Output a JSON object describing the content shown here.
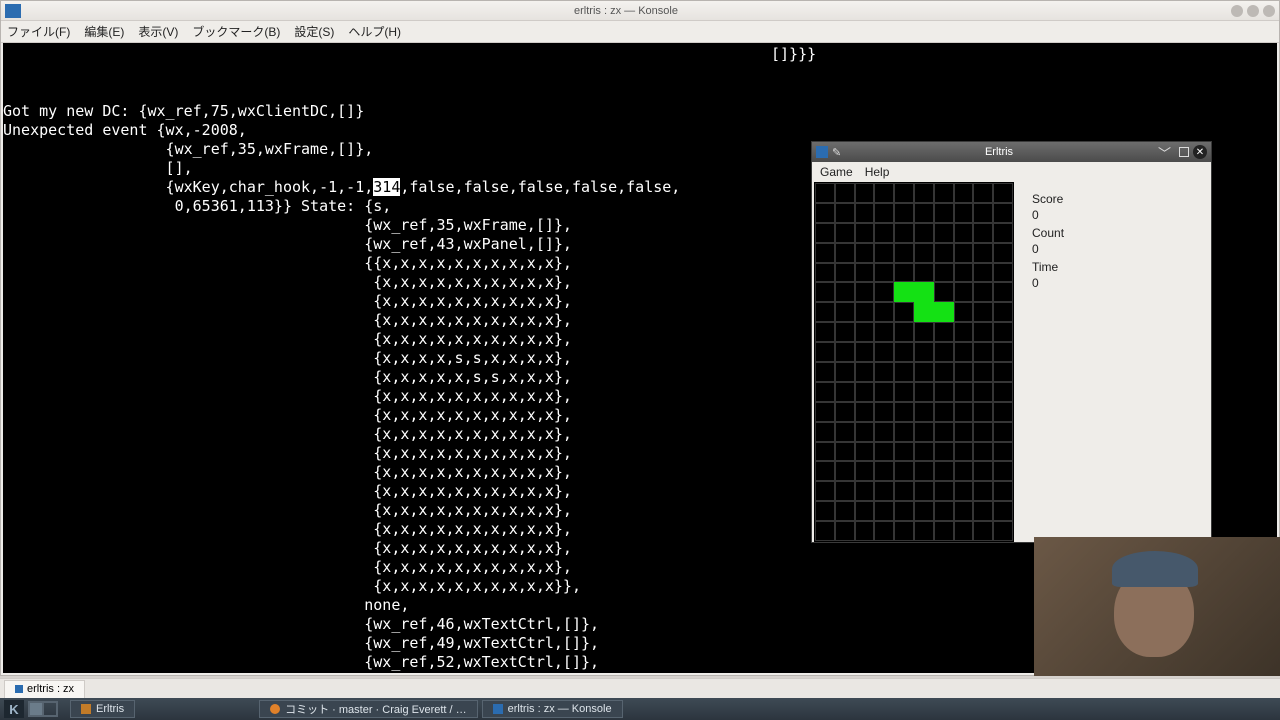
{
  "konsole": {
    "title": "erltris : zx — Konsole",
    "menu": [
      "ファイル(F)",
      "編集(E)",
      "表示(V)",
      "ブックマーク(B)",
      "設定(S)",
      "ヘルプ(H)"
    ],
    "tab": "erltris : zx"
  },
  "terminal": {
    "topright": "[]}}}",
    "l1": "Got my new DC: {wx_ref,75,wxClientDC,[]}",
    "l2": "Unexpected event {wx,-2008,",
    "l3": "                  {wx_ref,35,wxFrame,[]},",
    "l4": "                  [],",
    "l5a": "                  {wxKey,char_hook,-1,-1,",
    "l5h": "314",
    "l5b": ",false,false,false,false,false,",
    "l6": "                   0,65361,113}} State: {s,",
    "l7": "                                        {wx_ref,35,wxFrame,[]},",
    "l8": "                                        {wx_ref,43,wxPanel,[]},",
    "l9": "                                        {{x,x,x,x,x,x,x,x,x,x},",
    "row": "                                         {x,x,x,x,x,x,x,x,x,x},",
    "rowS1": "                                         {x,x,x,x,s,s,x,x,x,x},",
    "rowS2": "                                         {x,x,x,x,x,s,s,x,x,x},",
    "rowEnd": "                                         {x,x,x,x,x,x,x,x,x,x}},",
    "l_none": "                                        none,",
    "l_t1": "                                        {wx_ref,46,wxTextCtrl,[]},",
    "l_t2": "                                        {wx_ref,49,wxTextCtrl,[]},",
    "l_t3": "                                        {wx_ref,52,wxTextCtrl,[]},"
  },
  "game": {
    "title": "Erltris",
    "menu": [
      "Game",
      "Help"
    ],
    "stats": {
      "score_label": "Score",
      "score_value": "0",
      "count_label": "Count",
      "count_value": "0",
      "time_label": "Time",
      "time_value": "0"
    },
    "board": {
      "cols": 10,
      "rows": 18,
      "filled": [
        [
          5,
          4
        ],
        [
          5,
          5
        ],
        [
          6,
          5
        ],
        [
          6,
          6
        ]
      ]
    }
  },
  "taskbar": {
    "items": [
      {
        "kind": "app",
        "label": "Erltris"
      },
      {
        "kind": "firefox",
        "label": "コミット · master · Craig Everett / …"
      },
      {
        "kind": "konsole",
        "label": "erltris : zx — Konsole"
      }
    ]
  }
}
